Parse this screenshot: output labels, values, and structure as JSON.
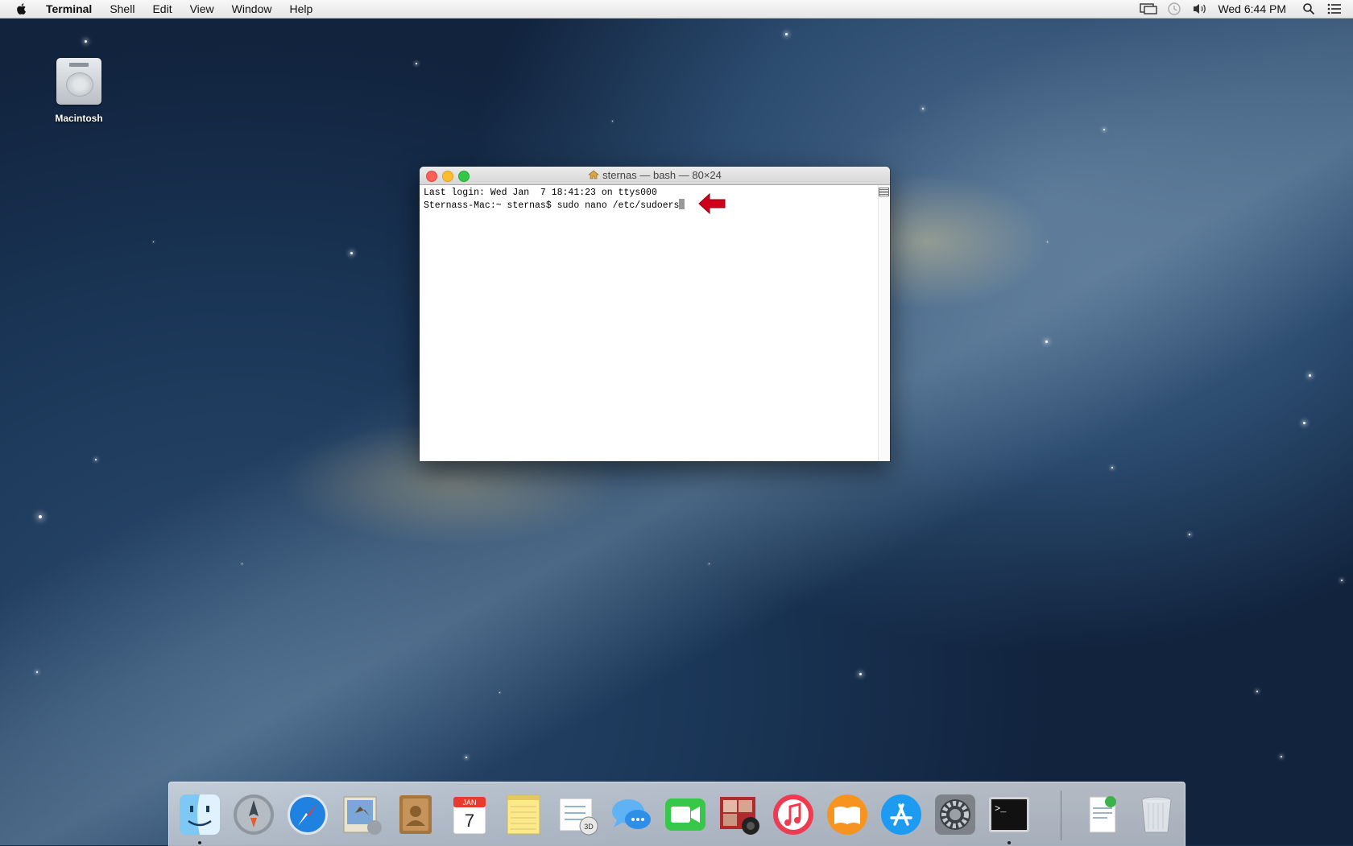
{
  "menubar": {
    "app_name": "Terminal",
    "menus": [
      "Shell",
      "Edit",
      "View",
      "Window",
      "Help"
    ],
    "clock": "Wed 6:44 PM"
  },
  "desktop": {
    "drive_label": "Macintosh"
  },
  "terminal": {
    "title": "sternas — bash — 80×24",
    "lines": [
      "Last login: Wed Jan  7 18:41:23 on ttys000",
      "Sternass-Mac:~ sternas$ sudo nano /etc/sudoers"
    ]
  },
  "dock": {
    "items": [
      "finder-icon",
      "launchpad-icon",
      "safari-icon",
      "mail-icon",
      "contacts-icon",
      "calendar-icon",
      "notes-icon",
      "reminders-icon",
      "messages-icon",
      "facetime-icon",
      "photo-booth-icon",
      "itunes-icon",
      "ibooks-icon",
      "app-store-icon",
      "system-preferences-icon",
      "terminal-icon"
    ],
    "calendar_month": "JAN",
    "calendar_day": "7",
    "terminal_glyph": ">_"
  },
  "colors": {
    "arrow": "#d0021b",
    "close": "#fc5f57",
    "minimize": "#fdbc2e",
    "zoom": "#33c748"
  }
}
